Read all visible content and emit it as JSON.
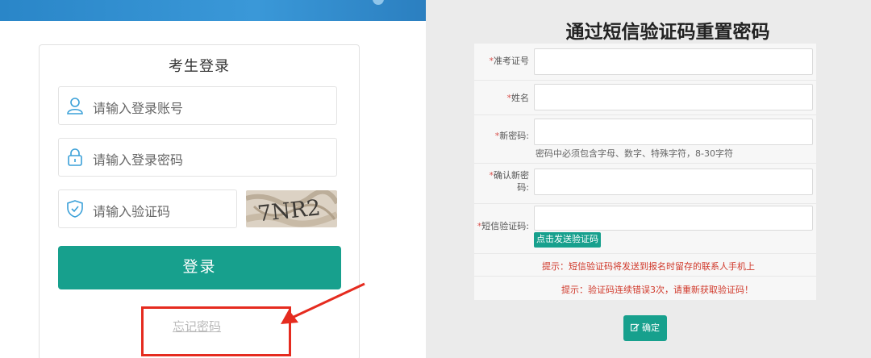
{
  "login": {
    "title": "考生登录",
    "account_placeholder": "请输入登录账号",
    "password_placeholder": "请输入登录密码",
    "captcha_placeholder": "请输入验证码",
    "captcha_text": "7NR2",
    "login_button": "登录",
    "forgot_password": "忘记密码",
    "icons": {
      "account": "user-icon",
      "password": "lock-icon",
      "captcha": "shield-check-icon"
    }
  },
  "reset": {
    "title": "通过短信验证码重置密码",
    "fields": {
      "exam_id_label": "准考证号",
      "name_label": "姓名",
      "new_password_label": "新密码:",
      "new_password_hint": "密码中必须包含字母、数字、特殊字符，8-30字符",
      "confirm_password_label_line1": "确认新密",
      "confirm_password_label_line2": "码:",
      "sms_code_label": "短信验证码:"
    },
    "required_mark": "*",
    "send_sms_button": "点击发送验证码",
    "tip1": "提示：短信验证码将发送到报名时留存的联系人手机上",
    "tip2": "提示：验证码连续错误3次，请重新获取验证码！",
    "confirm_button": "确定"
  },
  "colors": {
    "accent_green": "#17a08d",
    "annotation_red": "#e52b1f",
    "tip_red": "#d0392b",
    "banner_blue": "#2a86c8"
  }
}
